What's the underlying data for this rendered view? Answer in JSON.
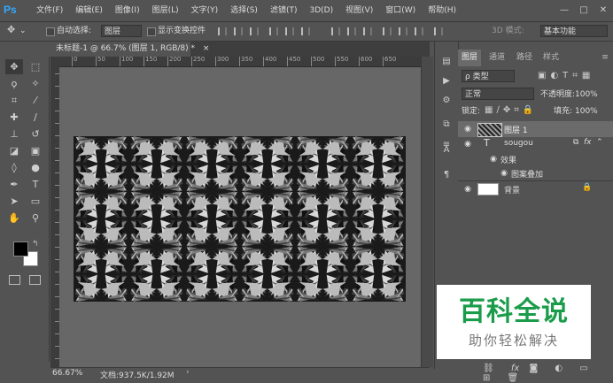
{
  "app": {
    "logo": "Ps"
  },
  "menu": [
    "文件(F)",
    "编辑(E)",
    "图像(I)",
    "图层(L)",
    "文字(Y)",
    "选择(S)",
    "滤镜(T)",
    "3D(D)",
    "视图(V)",
    "窗口(W)",
    "帮助(H)"
  ],
  "window_controls": {
    "minimize": "—",
    "maximize": "□",
    "close": "✕"
  },
  "options": {
    "auto_select_label": "自动选择:",
    "auto_select_value": "图层",
    "show_transform_label": "显示变换控件",
    "mode_3d_label": "3D 模式:",
    "workspace": "基本功能"
  },
  "document": {
    "tab_title": "未标题-1 @ 66.7% (图层 1, RGB/8) *",
    "tab_close": "×",
    "zoom": "66.67%",
    "doc_info": "文档:937.5K/1.92M"
  },
  "toolbar": {
    "tools": [
      {
        "name": "move-tool",
        "glyph": "✥"
      },
      {
        "name": "marquee-tool",
        "glyph": "⬚"
      },
      {
        "name": "lasso-tool",
        "glyph": "ϙ"
      },
      {
        "name": "magic-wand-tool",
        "glyph": "✧"
      },
      {
        "name": "crop-tool",
        "glyph": "⌗"
      },
      {
        "name": "eyedropper-tool",
        "glyph": "⁄"
      },
      {
        "name": "healing-tool",
        "glyph": "✚"
      },
      {
        "name": "brush-tool",
        "glyph": "∕"
      },
      {
        "name": "stamp-tool",
        "glyph": "⊥"
      },
      {
        "name": "history-brush-tool",
        "glyph": "↺"
      },
      {
        "name": "eraser-tool",
        "glyph": "◪"
      },
      {
        "name": "gradient-tool",
        "glyph": "▣"
      },
      {
        "name": "blur-tool",
        "glyph": "◊"
      },
      {
        "name": "dodge-tool",
        "glyph": "●"
      },
      {
        "name": "pen-tool",
        "glyph": "✒"
      },
      {
        "name": "type-tool",
        "glyph": "T"
      },
      {
        "name": "path-select-tool",
        "glyph": "➤"
      },
      {
        "name": "shape-tool",
        "glyph": "▭"
      },
      {
        "name": "hand-tool",
        "glyph": "✋"
      },
      {
        "name": "zoom-tool",
        "glyph": "⚲"
      }
    ]
  },
  "ruler": {
    "top_labels": [
      "0",
      "50",
      "100",
      "150",
      "200",
      "250",
      "300",
      "350",
      "400",
      "450",
      "500",
      "550",
      "600",
      "650"
    ]
  },
  "layers_panel": {
    "tabs": [
      "图层",
      "通道",
      "路径",
      "样式"
    ],
    "filter_value": "ρ 类型",
    "blend_mode": "正常",
    "opacity_label": "不透明度:",
    "opacity_value": "100%",
    "lock_label": "锁定:",
    "fill_label": "填充:",
    "fill_value": "100%",
    "layers": [
      {
        "name": "图层 1",
        "type": "pattern",
        "selected": true
      },
      {
        "name": "sougou",
        "type": "text"
      },
      {
        "name": "效果",
        "type": "effects-header"
      },
      {
        "name": "图案叠加",
        "type": "effect"
      },
      {
        "name": "背景",
        "type": "background"
      }
    ],
    "fx_badge": "fx"
  },
  "watermark": {
    "title": "百科全说",
    "subtitle": "助你轻松解决"
  },
  "colors": {
    "panel": "#535353",
    "canvas_bg": "#676767",
    "selected_layer": "#6b6b6b",
    "brand": "#1a9c4a",
    "ps_blue": "#31a8ff"
  }
}
